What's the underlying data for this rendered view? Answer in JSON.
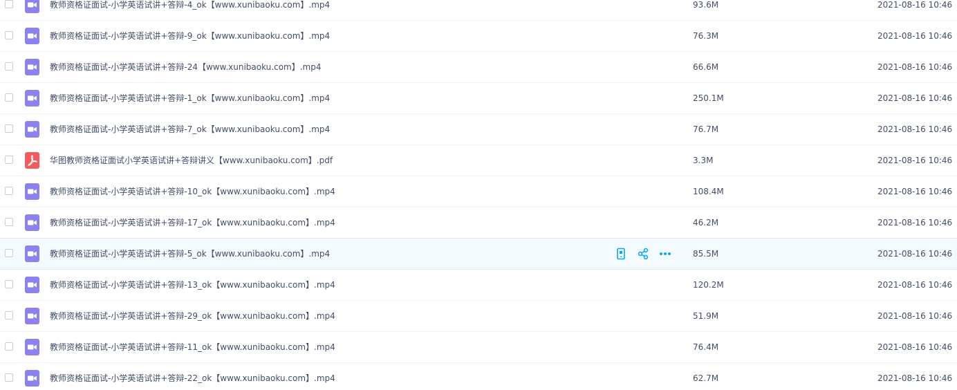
{
  "colors": {
    "video_icon": "#8c82ee",
    "pdf_icon": "#f25b5b",
    "action_icon": "#06a7ff",
    "hover_row_bg": "#f4fbff"
  },
  "hover_actions": [
    "phone-icon",
    "share-icon",
    "more-icon"
  ],
  "files": [
    {
      "name": "教师资格证面试-小学英语试讲+答辩-4_ok【www.xunibaoku.com】.mp4",
      "size": "93.6M",
      "date": "2021-08-16 10:46",
      "type": "video-icon"
    },
    {
      "name": "教师资格证面试-小学英语试讲+答辩-9_ok【www.xunibaoku.com】.mp4",
      "size": "76.3M",
      "date": "2021-08-16 10:46",
      "type": "video-icon"
    },
    {
      "name": "教师资格证面试-小学英语试讲+答辩-24【www.xunibaoku.com】.mp4",
      "size": "66.6M",
      "date": "2021-08-16 10:46",
      "type": "video-icon"
    },
    {
      "name": "教师资格证面试-小学英语试讲+答辩-1_ok【www.xunibaoku.com】.mp4",
      "size": "250.1M",
      "date": "2021-08-16 10:46",
      "type": "video-icon"
    },
    {
      "name": "教师资格证面试-小学英语试讲+答辩-7_ok【www.xunibaoku.com】.mp4",
      "size": "76.7M",
      "date": "2021-08-16 10:46",
      "type": "video-icon"
    },
    {
      "name": "华图教师资格证面试小学英语试讲+答辩讲义【www.xunibaoku.com】.pdf",
      "size": "3.3M",
      "date": "2021-08-16 10:46",
      "type": "pdf-icon"
    },
    {
      "name": "教师资格证面试-小学英语试讲+答辩-10_ok【www.xunibaoku.com】.mp4",
      "size": "108.4M",
      "date": "2021-08-16 10:46",
      "type": "video-icon"
    },
    {
      "name": "教师资格证面试-小学英语试讲+答辩-17_ok【www.xunibaoku.com】.mp4",
      "size": "46.2M",
      "date": "2021-08-16 10:46",
      "type": "video-icon"
    },
    {
      "name": "教师资格证面试-小学英语试讲+答辩-5_ok【www.xunibaoku.com】.mp4",
      "size": "85.5M",
      "date": "2021-08-16 10:46",
      "type": "video-icon",
      "hovered": true
    },
    {
      "name": "教师资格证面试-小学英语试讲+答辩-13_ok【www.xunibaoku.com】.mp4",
      "size": "120.2M",
      "date": "2021-08-16 10:46",
      "type": "video-icon"
    },
    {
      "name": "教师资格证面试-小学英语试讲+答辩-29_ok【www.xunibaoku.com】.mp4",
      "size": "51.9M",
      "date": "2021-08-16 10:46",
      "type": "video-icon"
    },
    {
      "name": "教师资格证面试-小学英语试讲+答辩-11_ok【www.xunibaoku.com】.mp4",
      "size": "76.4M",
      "date": "2021-08-16 10:46",
      "type": "video-icon"
    },
    {
      "name": "教师资格证面试-小学英语试讲+答辩-22_ok【www.xunibaoku.com】.mp4",
      "size": "62.7M",
      "date": "2021-08-16 10:46",
      "type": "video-icon"
    }
  ]
}
